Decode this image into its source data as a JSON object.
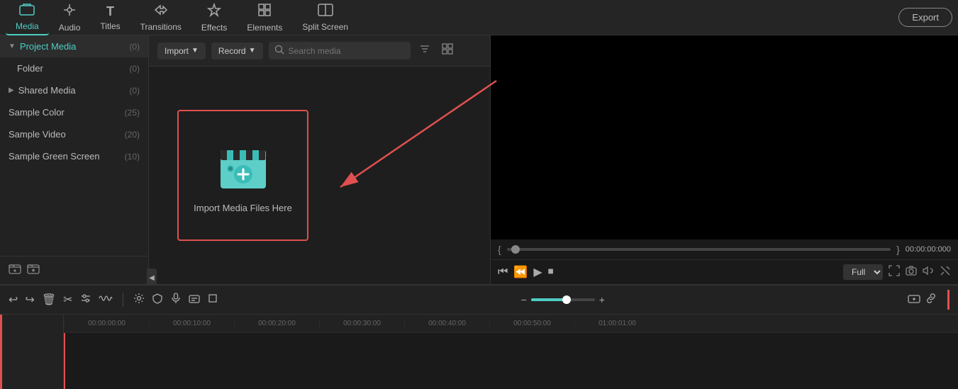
{
  "nav": {
    "items": [
      {
        "id": "media",
        "label": "Media",
        "icon": "🎬",
        "active": true
      },
      {
        "id": "audio",
        "label": "Audio",
        "icon": "🎵",
        "active": false
      },
      {
        "id": "titles",
        "label": "Titles",
        "icon": "T",
        "active": false
      },
      {
        "id": "transitions",
        "label": "Transitions",
        "icon": "✦",
        "active": false
      },
      {
        "id": "effects",
        "label": "Effects",
        "icon": "✳",
        "active": false
      },
      {
        "id": "elements",
        "label": "Elements",
        "icon": "❖",
        "active": false
      },
      {
        "id": "splitscreen",
        "label": "Split Screen",
        "icon": "⊞",
        "active": false
      }
    ],
    "export_label": "Export"
  },
  "sidebar": {
    "project_media": {
      "label": "Project Media",
      "count": "(0)"
    },
    "folder": {
      "label": "Folder",
      "count": "(0)"
    },
    "shared_media": {
      "label": "Shared Media",
      "count": "(0)"
    },
    "sample_color": {
      "label": "Sample Color",
      "count": "(25)"
    },
    "sample_video": {
      "label": "Sample Video",
      "count": "(20)"
    },
    "sample_green_screen": {
      "label": "Sample Green Screen",
      "count": "(10)"
    }
  },
  "toolbar": {
    "import_label": "Import",
    "record_label": "Record",
    "search_placeholder": "Search media"
  },
  "import_box": {
    "label": "Import Media Files Here"
  },
  "preview": {
    "timecode": "00:00:00:000",
    "quality": "Full"
  },
  "timeline": {
    "ticks": [
      "00:00:00:00",
      "00:00:10:00",
      "00:00:20:00",
      "00:00:30:00",
      "00:00:40:00",
      "00:00:50:00",
      "01:00:01:00"
    ]
  }
}
